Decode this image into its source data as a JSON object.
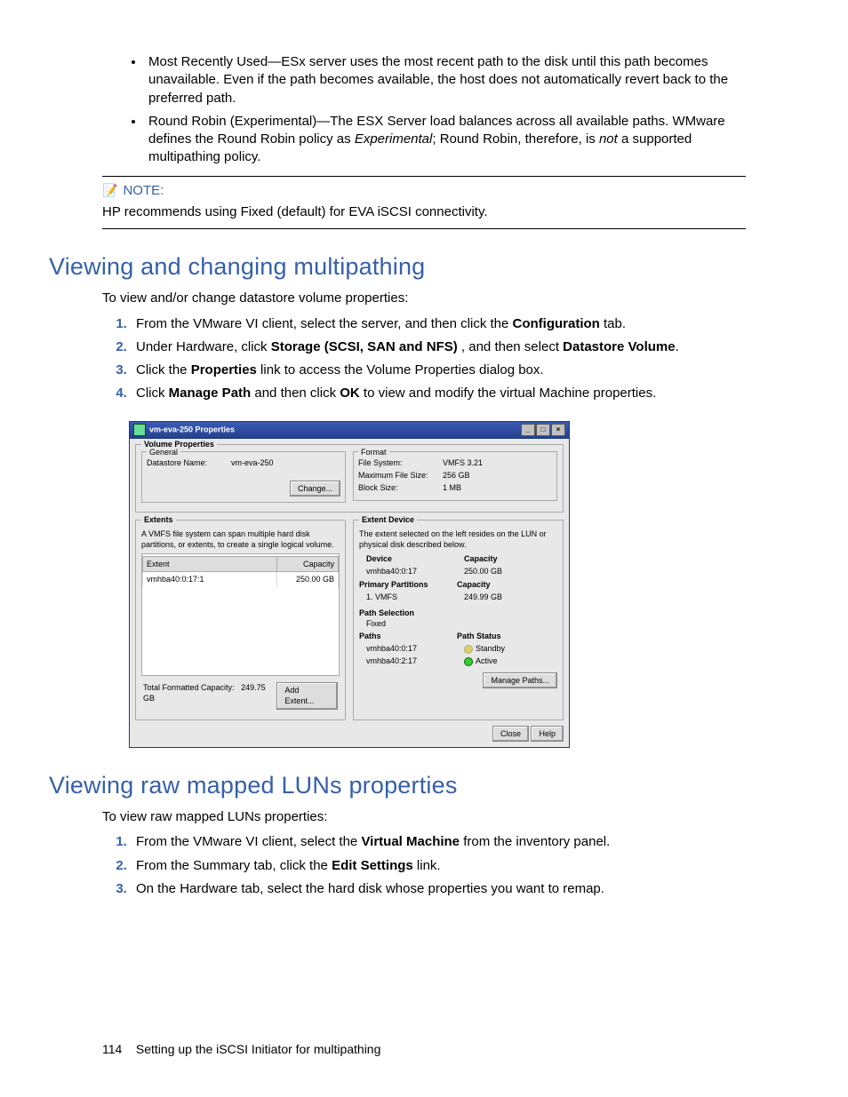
{
  "bullets": [
    "Most Recently Used—ESx server uses the most recent path to the disk until this path becomes unavailable. Even if the path becomes available, the host does not automatically revert back to the preferred path.",
    "Round Robin (Experimental)—The ESX Server load balances across all available paths. WMware defines the Round Robin policy as Experimental; Round Robin, therefore, is not a supported multipathing policy."
  ],
  "note": {
    "label": "NOTE:",
    "text": "HP recommends using Fixed (default) for EVA iSCSI connectivity."
  },
  "section1": {
    "title": "Viewing and changing multipathing",
    "intro": "To view and/or change datastore volume properties:",
    "steps": [
      {
        "pre": "From the VMware VI client, select the server, and then click the ",
        "b1": "Configuration",
        "post": " tab."
      },
      {
        "pre": "Under Hardware, click ",
        "b1": "Storage (SCSI, SAN and NFS)",
        "mid": " , and then select ",
        "b2": "Datastore Volume",
        "post": "."
      },
      {
        "pre": "Click the ",
        "b1": "Properties",
        "post": " link to access the Volume Properties dialog box."
      },
      {
        "pre": "Click ",
        "b1": "Manage Path",
        "mid": " and then click ",
        "b2": "OK",
        "post": " to view and modify the virtual Machine properties."
      }
    ]
  },
  "dialog": {
    "title": "vm-eva-250 Properties",
    "volProps": "Volume Properties",
    "general": "General",
    "dsNameLbl": "Datastore Name:",
    "dsName": "vm-eva-250",
    "changeBtn": "Change...",
    "format": "Format",
    "fsLbl": "File System:",
    "fs": "VMFS 3.21",
    "maxLbl": "Maximum File Size:",
    "max": "256 GB",
    "blkLbl": "Block Size:",
    "blk": "1 MB",
    "extents": "Extents",
    "extDesc": "A VMFS file system can span multiple hard disk partitions, or extents, to create a single logical volume.",
    "extColExtent": "Extent",
    "extColCap": "Capacity",
    "extRowName": "vmhba40:0:17:1",
    "extRowCap": "250.00 GB",
    "tfcLbl": "Total Formatted Capacity:",
    "tfc": "249.75 GB",
    "addExtent": "Add Extent...",
    "extDev": "Extent Device",
    "extDevDesc": "The extent selected on the left resides on the LUN or physical disk described below.",
    "devHdr": "Device",
    "capHdr": "Capacity",
    "devName": "vmhba40:0:17",
    "devCap": "250.00 GB",
    "primPart": "Primary Partitions",
    "vmfsRow": "1. VMFS",
    "vmfsCap": "249.99 GB",
    "pathSel": "Path Selection",
    "pathSelVal": "Fixed",
    "pathsHdr": "Paths",
    "pathStatus": "Path Status",
    "p1": "vmhba40:0:17",
    "p1s": "Standby",
    "p2": "vmhba40:2:17",
    "p2s": "Active",
    "managePaths": "Manage Paths...",
    "close": "Close",
    "help": "Help"
  },
  "section2": {
    "title": "Viewing raw mapped LUNs properties",
    "intro": "To view raw mapped LUNs properties:",
    "steps": [
      {
        "pre": "From the VMware VI client, select the ",
        "b1": "Virtual Machine",
        "post": " from the inventory panel."
      },
      {
        "pre": "From the Summary tab, click the ",
        "b1": "Edit Settings",
        "post": " link."
      },
      {
        "pre": "On the Hardware tab, select the hard disk whose properties you want to remap.",
        "b1": "",
        "post": ""
      }
    ]
  },
  "footer": {
    "page": "114",
    "text": "Setting up the iSCSI Initiator for multipathing"
  }
}
